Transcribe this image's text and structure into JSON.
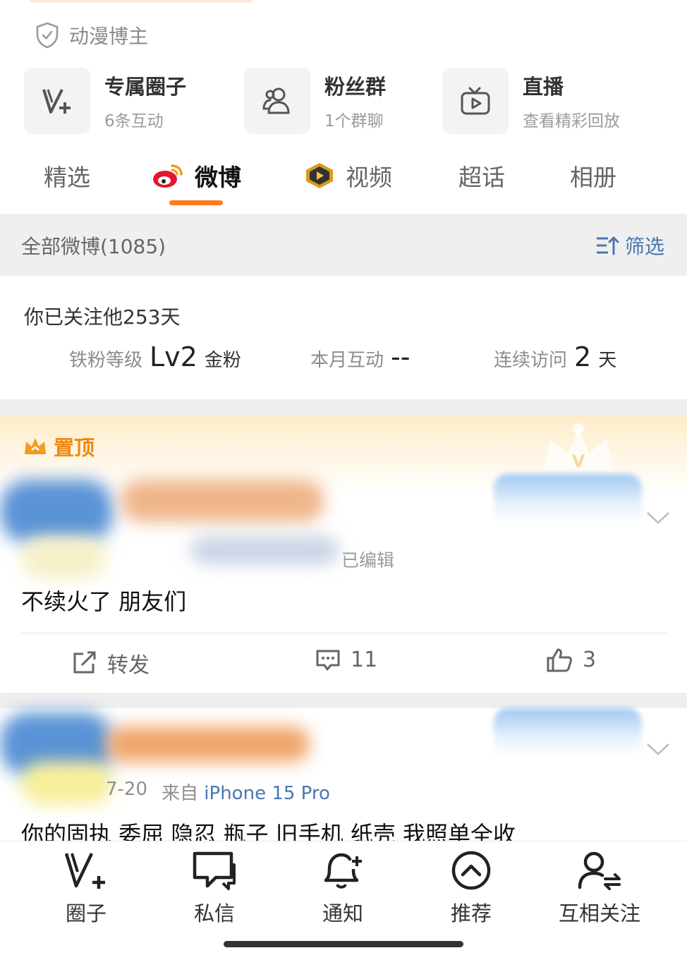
{
  "verification": {
    "label": "动漫博主",
    "icon": "shield-check-icon"
  },
  "features": [
    {
      "title": "专属圈子",
      "subtitle": "6条互动",
      "icon": "v-plus-icon"
    },
    {
      "title": "粉丝群",
      "subtitle": "1个群聊",
      "icon": "group-icon"
    },
    {
      "title": "直播",
      "subtitle": "查看精彩回放",
      "icon": "tv-icon"
    }
  ],
  "tabs": [
    {
      "label": "精选"
    },
    {
      "label": "微博",
      "active": true,
      "icon": "weibo-logo-icon"
    },
    {
      "label": "视频",
      "icon": "video-badge-icon"
    },
    {
      "label": "超话"
    },
    {
      "label": "相册"
    }
  ],
  "section": {
    "title": "全部微博(1085)",
    "filter_label": "筛选",
    "filter_icon": "sort-filter-icon"
  },
  "fan_info": {
    "follow_text": "你已关注他253天",
    "level_label": "铁粉等级",
    "level_value": "Lv2",
    "level_suffix": "金粉",
    "month_label": "本月互动",
    "month_value": "--",
    "visit_label": "连续访问",
    "visit_value": "2",
    "visit_suffix": "天"
  },
  "posts": [
    {
      "pinned_label": "置顶",
      "meta": "已编辑",
      "text": "不续火了 朋友们",
      "repost_label": "转发",
      "comments": "11",
      "likes": "3"
    },
    {
      "date": "7-20",
      "source_prefix": "来自",
      "source": "iPhone 15 Pro",
      "text": "你的固执 委屈 隐忍 瓶子 旧手机 纸壳 我照单全收"
    }
  ],
  "bottom_nav": [
    {
      "label": "圈子",
      "icon": "v-plus-icon"
    },
    {
      "label": "私信",
      "icon": "chat-icon"
    },
    {
      "label": "通知",
      "icon": "bell-plus-icon"
    },
    {
      "label": "推荐",
      "icon": "chevron-up-circle-icon"
    },
    {
      "label": "互相关注",
      "icon": "mutual-follow-icon"
    }
  ],
  "colors": {
    "accent": "#ff7a1c",
    "link": "#4a77b0",
    "pinned": "#f08a10"
  }
}
